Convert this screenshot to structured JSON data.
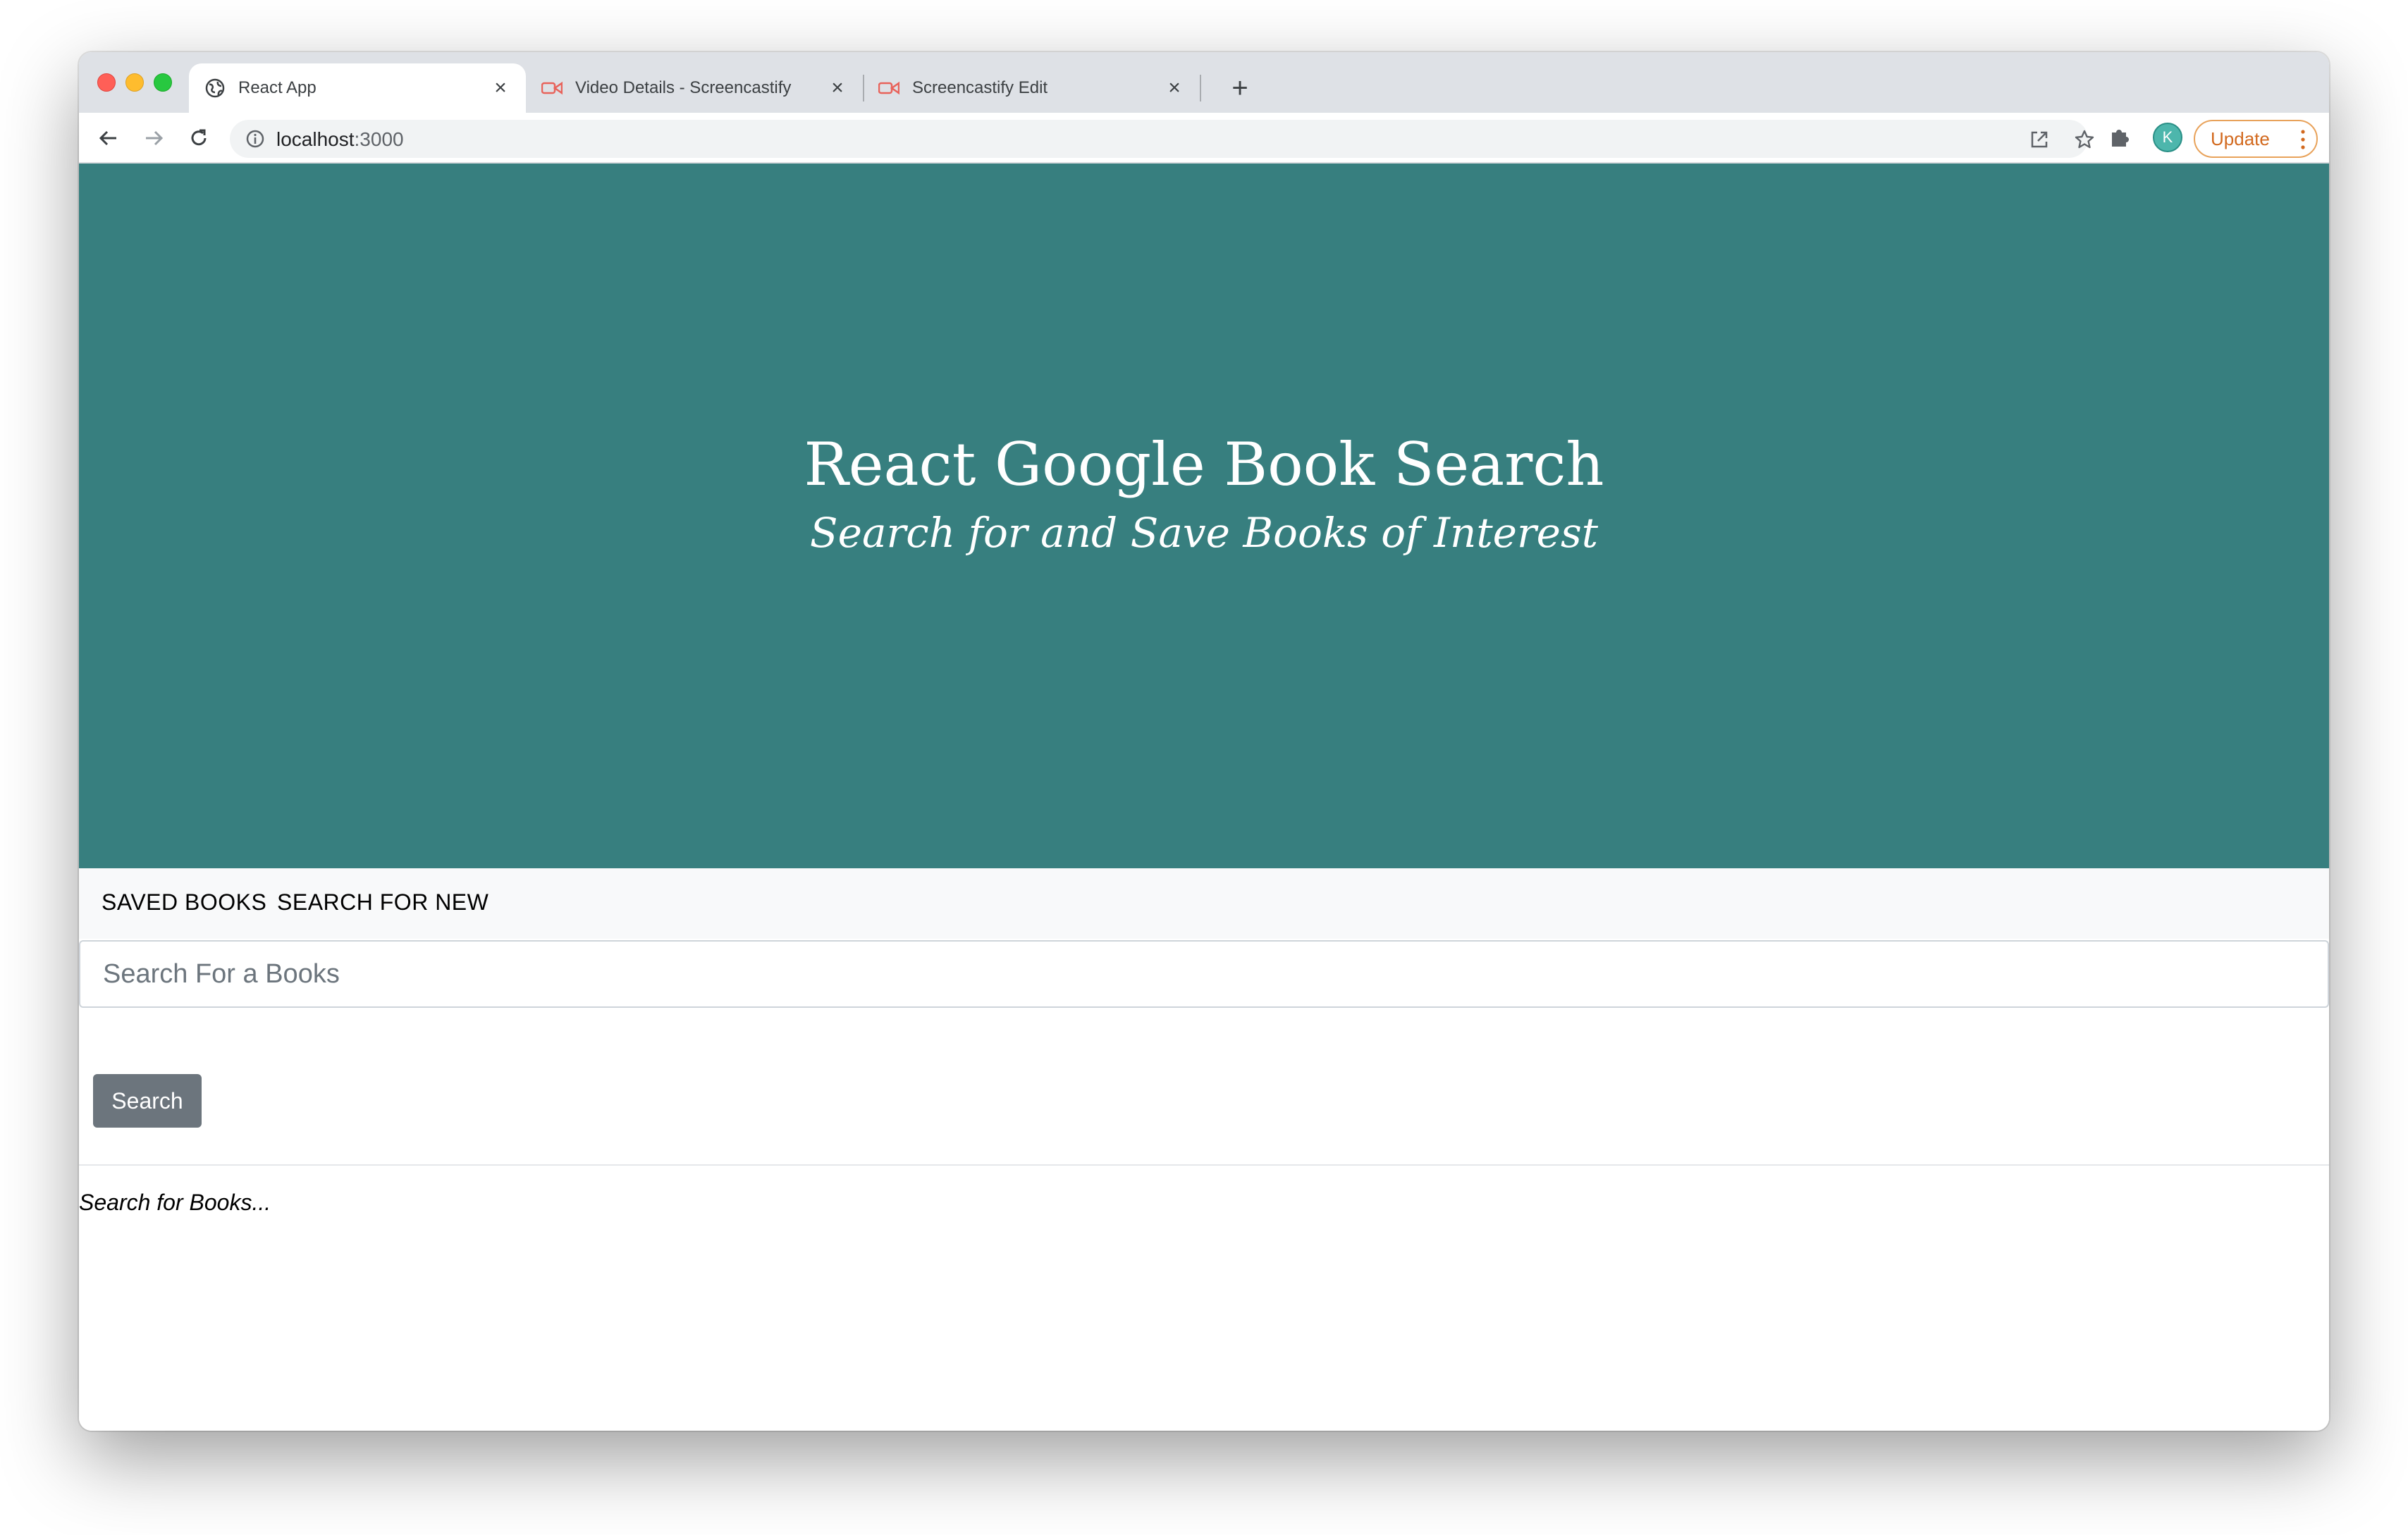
{
  "browser": {
    "tabs": [
      {
        "title": "React App",
        "favicon": "globe-icon",
        "active": true
      },
      {
        "title": "Video Details - Screencastify",
        "favicon": "screencastify-icon",
        "active": false
      },
      {
        "title": "Screencastify Edit",
        "favicon": "screencastify-icon",
        "active": false
      }
    ],
    "address": {
      "host": "localhost",
      "port": ":3000"
    },
    "update_label": "Update",
    "profile_initial": "K"
  },
  "colors": {
    "hero_bg": "#377f7f",
    "navbar_bg": "#f8f9fa",
    "search_button_bg": "#6c757d",
    "update_accent": "#d2691e"
  },
  "hero": {
    "title": "React Google Book Search",
    "subtitle": "Search for and Save Books of Interest"
  },
  "nav": {
    "saved_label": "SAVED BOOKS",
    "search_label": "SEARCH FOR NEW"
  },
  "search": {
    "placeholder": "Search For a Books",
    "value": "",
    "button_label": "Search"
  },
  "results": {
    "message": "Search for Books..."
  }
}
